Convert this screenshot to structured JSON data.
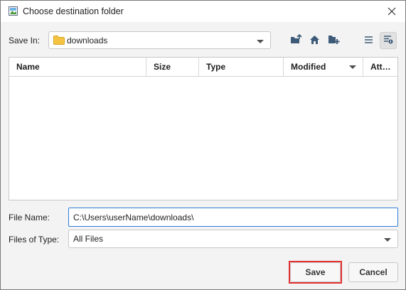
{
  "window": {
    "title": "Choose destination folder"
  },
  "save_in": {
    "label": "Save In:",
    "value": "downloads"
  },
  "toolbar": {
    "up_folder": "up-folder-icon",
    "home": "home-icon",
    "new_folder": "new-folder-icon",
    "list_view": "list-view-icon",
    "details_view": "details-view-icon"
  },
  "table": {
    "columns": [
      "Name",
      "Size",
      "Type",
      "Modified",
      "Att…"
    ],
    "rows": []
  },
  "file_name": {
    "label": "File Name:",
    "value": "C:\\Users\\userName\\downloads\\"
  },
  "files_of_type": {
    "label": "Files of Type:",
    "value": "All Files"
  },
  "buttons": {
    "save": "Save",
    "cancel": "Cancel"
  },
  "colors": {
    "accent": "#2f7bd6",
    "highlight": "#e03030",
    "folder": "#f5c342"
  }
}
